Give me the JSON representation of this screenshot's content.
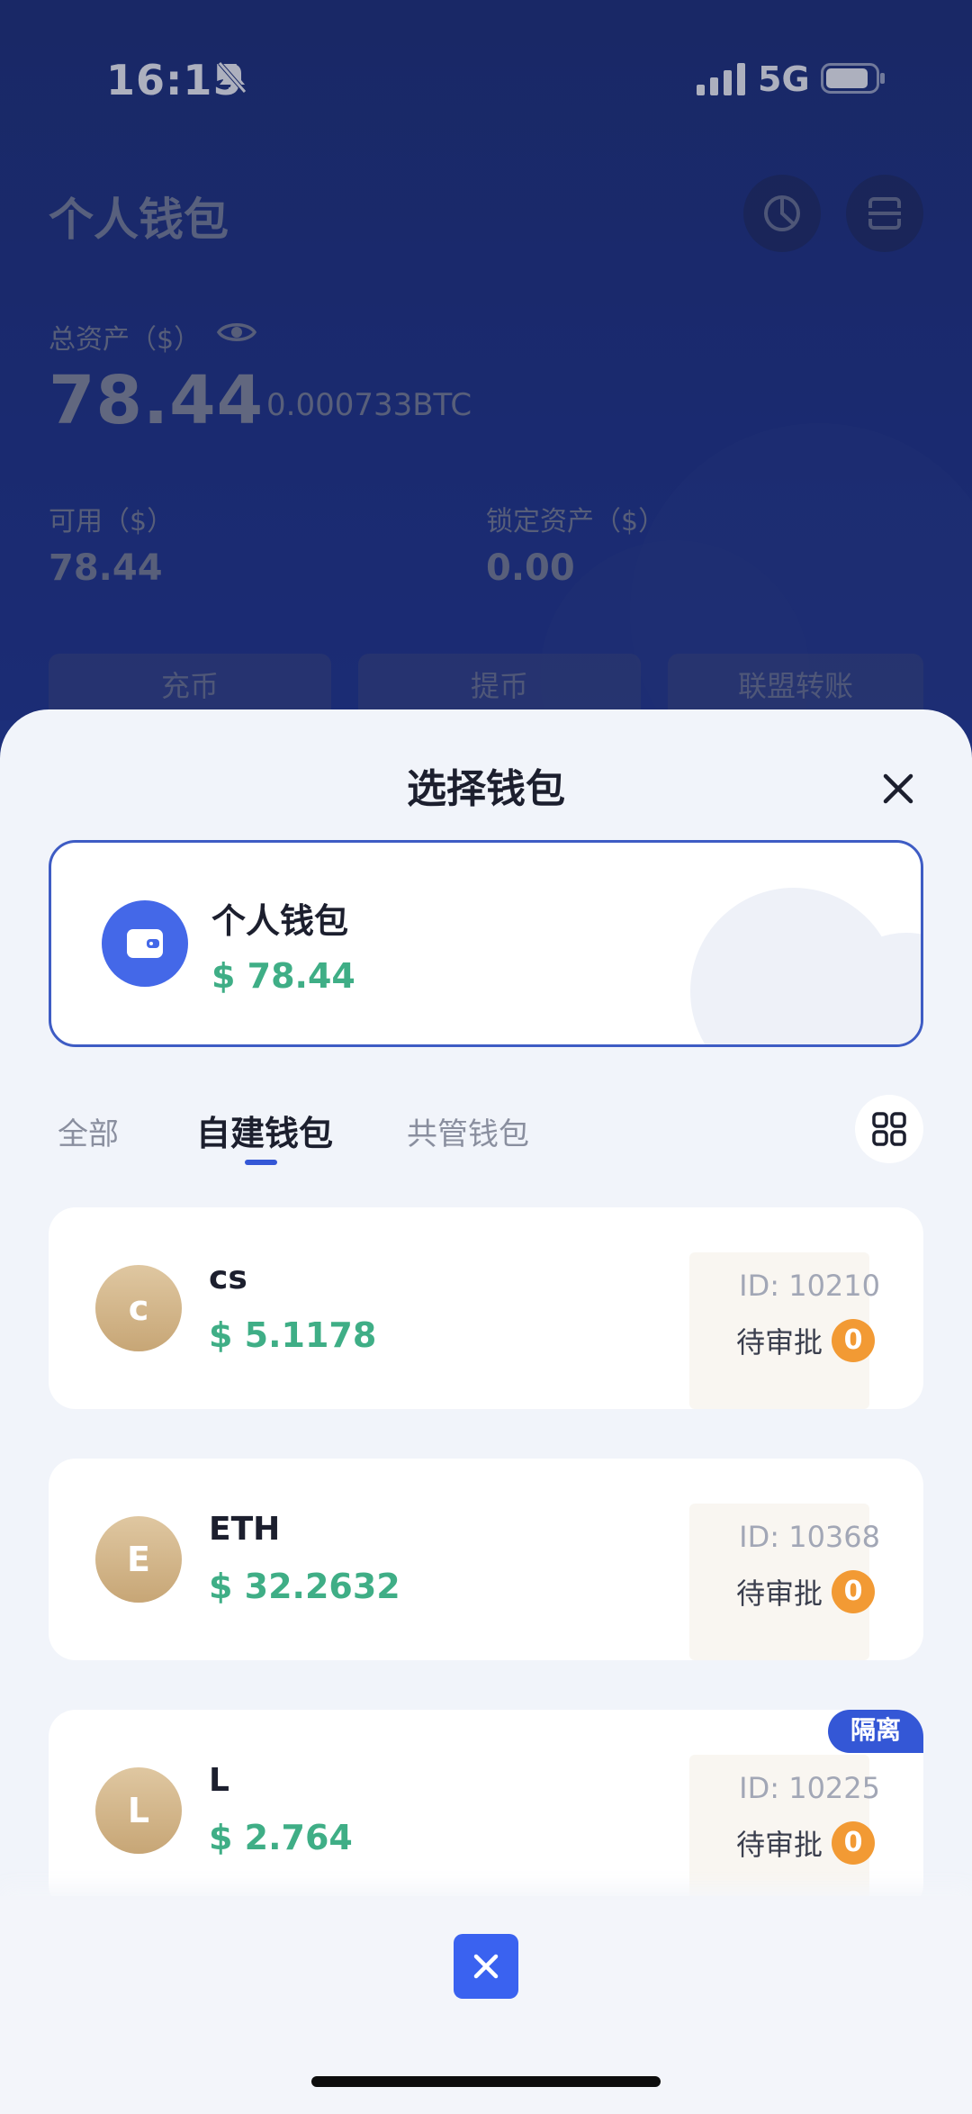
{
  "status": {
    "time": "16:15",
    "network": "5G"
  },
  "background": {
    "title": "个人钱包",
    "total_label": "总资产（$）",
    "total_value": "78.44",
    "total_btc": "0.000733BTC",
    "available_label": "可用（$）",
    "available_value": "78.44",
    "locked_label": "锁定资产（$）",
    "locked_value": "0.00",
    "btn_deposit": "充币",
    "btn_withdraw": "提币",
    "btn_transfer": "联盟转账"
  },
  "sheet": {
    "title": "选择钱包",
    "current": {
      "name": "个人钱包",
      "amount": "$ 78.44"
    },
    "tabs": [
      "全部",
      "自建钱包",
      "共管钱包"
    ],
    "active_tab": 1,
    "wallets": [
      {
        "initial": "c",
        "name": "cs",
        "amount": "$ 5.1178",
        "id": "ID: 10210",
        "pending_label": "待审批",
        "pending_count": "0",
        "tag": ""
      },
      {
        "initial": "E",
        "name": "ETH",
        "amount": "$ 32.2632",
        "id": "ID: 10368",
        "pending_label": "待审批",
        "pending_count": "0",
        "tag": ""
      },
      {
        "initial": "L",
        "name": "L",
        "amount": "$ 2.764",
        "id": "ID: 10225",
        "pending_label": "待审批",
        "pending_count": "0",
        "tag": "隔离"
      }
    ]
  },
  "colors": {
    "accent": "#3457d6",
    "amount": "#3fae86",
    "badge": "#f29a34"
  }
}
